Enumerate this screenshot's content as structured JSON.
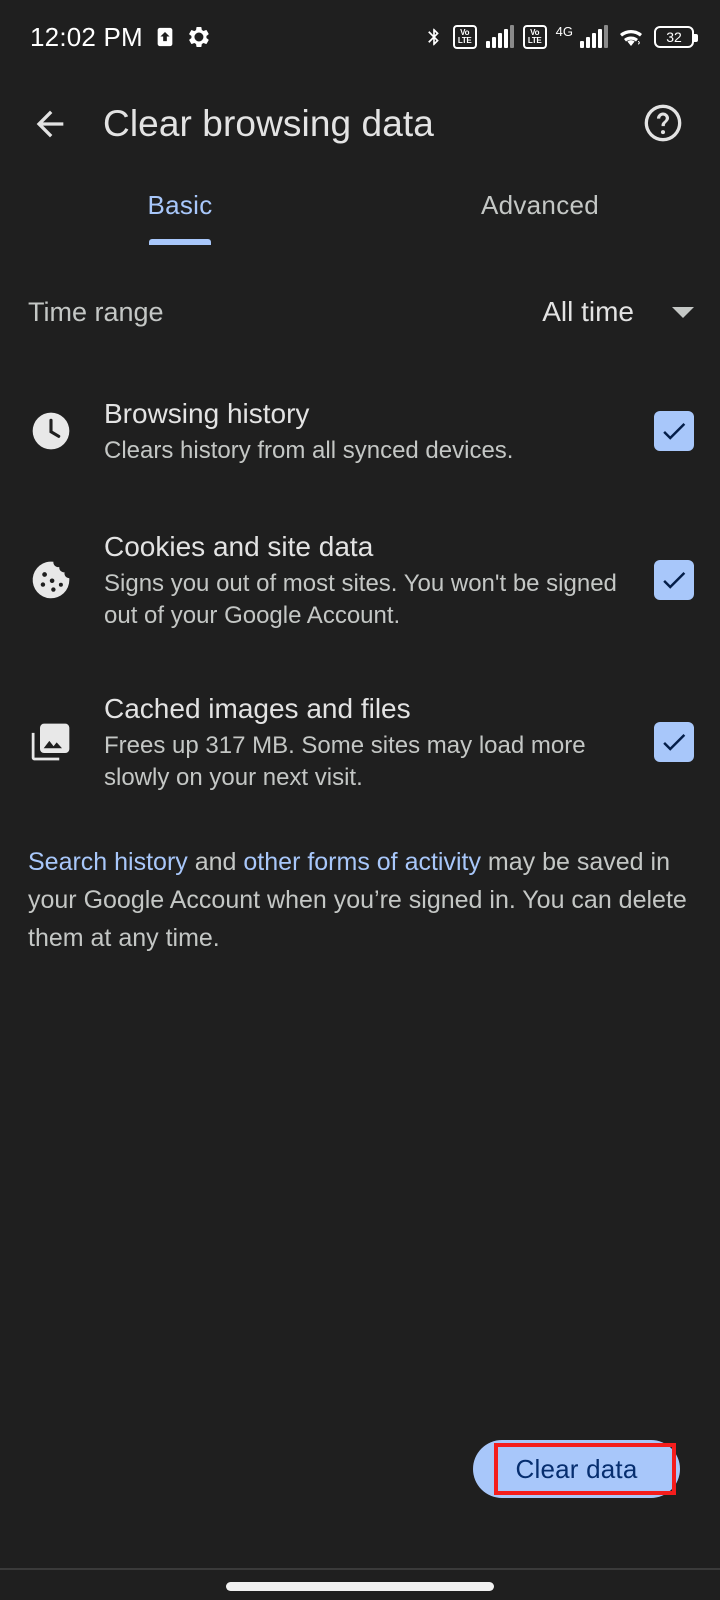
{
  "status_bar": {
    "time": "12:02 PM",
    "icons": [
      "upload-arrow-icon",
      "gear-icon",
      "bluetooth-icon",
      "volte-icon",
      "signal-bars-icon",
      "volte-icon",
      "4g-signal-icon",
      "wifi-icon",
      "battery-icon"
    ],
    "volte_top": "Vo",
    "volte_bottom": "LTE",
    "network_type": "4G",
    "battery_level": "32"
  },
  "app_bar": {
    "back_icon": "arrow-back-icon",
    "title": "Clear browsing data",
    "help_icon": "help-circle-icon"
  },
  "tabs": [
    {
      "label": "Basic",
      "active": true
    },
    {
      "label": "Advanced",
      "active": false
    }
  ],
  "time_range": {
    "label": "Time range",
    "value": "All time",
    "caret_icon": "chevron-down-icon"
  },
  "options": [
    {
      "icon": "clock-icon",
      "title": "Browsing history",
      "subtitle": "Clears history from all synced devices.",
      "checked": true
    },
    {
      "icon": "cookie-icon",
      "title": "Cookies and site data",
      "subtitle": "Signs you out of most sites. You won't be signed out of your Google Account.",
      "checked": true
    },
    {
      "icon": "photo-library-icon",
      "title": "Cached images and files",
      "subtitle": "Frees up 317 MB. Some sites may load more slowly on your next visit.",
      "checked": true
    }
  ],
  "footnote": {
    "link1": "Search history",
    "mid": " and ",
    "link2": "other forms of activity",
    "tail": " may be saved in your Google Account when you’re signed in. You can delete them at any time."
  },
  "clear_button": {
    "label": "Clear data"
  },
  "nav_bar": {
    "handle": "gesture-pill"
  },
  "colors": {
    "background": "#1f1f1f",
    "accent": "#a8c7fa",
    "text_primary": "#e3e3e3",
    "text_secondary": "#c4c7c5",
    "button_text": "#062e6f",
    "highlight": "#f41d1d"
  }
}
